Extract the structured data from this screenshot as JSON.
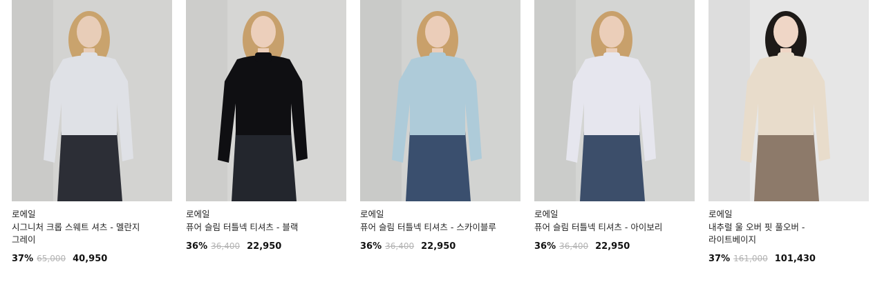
{
  "products": [
    {
      "brand": "로에일",
      "name": "시그니처 크롭 스웨트 셔츠 - 멜란지 그레이",
      "discount": "37%",
      "original_price": "65,000",
      "sale_price": "40,950",
      "colors": {
        "bg": "#d3d3d1",
        "top": "#dfe1e6",
        "bottom": "#2c2e36",
        "hair": "#c9a36d",
        "skin": "#e8cdb8"
      }
    },
    {
      "brand": "로에일",
      "name": "퓨어 슬림 터틀넥 티셔츠 - 블랙",
      "discount": "36%",
      "original_price": "36,400",
      "sale_price": "22,950",
      "colors": {
        "bg": "#d6d6d4",
        "top": "#0f0f12",
        "bottom": "#23262d",
        "hair": "#c7a06c",
        "skin": "#eccfbb"
      }
    },
    {
      "brand": "로에일",
      "name": "퓨어 슬림 터틀넥 티셔츠 - 스카이블루",
      "discount": "36%",
      "original_price": "36,400",
      "sale_price": "22,950",
      "colors": {
        "bg": "#d2d3d1",
        "top": "#aecbd9",
        "bottom": "#3a4f6e",
        "hair": "#c9a06a",
        "skin": "#ebcdb9"
      }
    },
    {
      "brand": "로에일",
      "name": "퓨어 슬림 터틀넥 티셔츠 - 아이보리",
      "discount": "36%",
      "original_price": "36,400",
      "sale_price": "22,950",
      "colors": {
        "bg": "#d4d5d3",
        "top": "#e6e6ee",
        "bottom": "#3c4e6a",
        "hair": "#c8a06b",
        "skin": "#ebceb9"
      }
    },
    {
      "brand": "로에일",
      "name": "내추럴 울 오버 핏 풀오버 - 라이트베이지",
      "discount": "37%",
      "original_price": "161,000",
      "sale_price": "101,430",
      "colors": {
        "bg": "#e6e6e6",
        "top": "#e8dccb",
        "bottom": "#8d7a6a",
        "hair": "#1d1a18",
        "skin": "#efd6c6"
      }
    }
  ]
}
